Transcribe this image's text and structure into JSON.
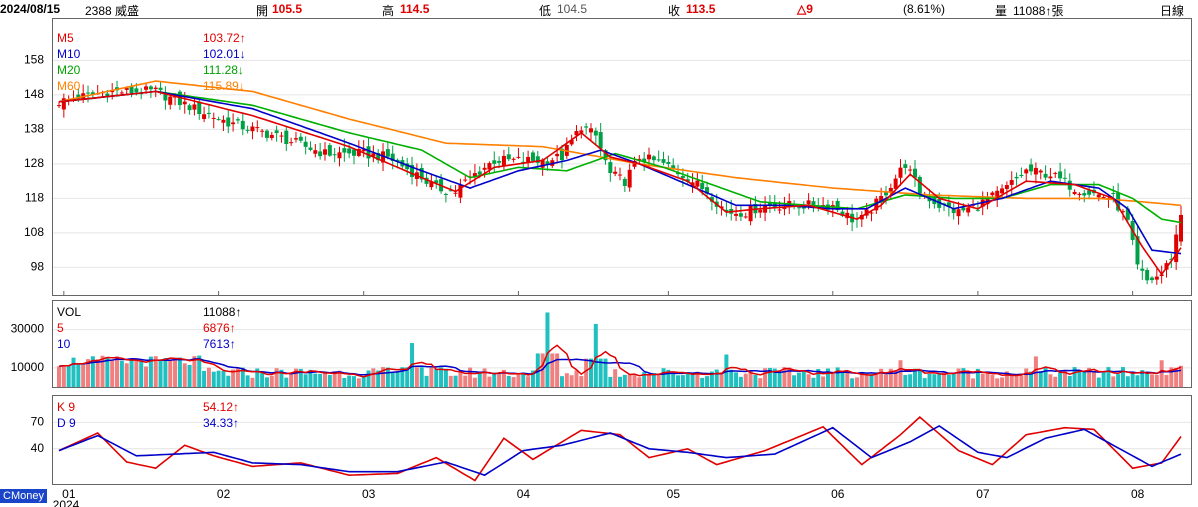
{
  "header": {
    "date": "2024/08/15",
    "stock": "2388 威盛",
    "open_label": "開",
    "open": "105.5",
    "high_label": "高",
    "high": "114.5",
    "low_label": "低",
    "low": "104.5",
    "close_label": "收",
    "close": "113.5",
    "change": "△9",
    "change_pct": "(8.61%)",
    "volume_label": "量",
    "volume": "11088↑張",
    "period": "日線"
  },
  "brand": "CMoney",
  "colors": {
    "up": "#e00000",
    "down": "#00a046",
    "ma5": "#e00000",
    "ma10": "#0000c8",
    "ma20": "#00b000",
    "ma60": "#ff8000",
    "vol_up": "#f08080",
    "vol_down": "#20c0c0"
  },
  "chart_data": [
    {
      "type": "candlestick",
      "legend": [
        {
          "name": "M5",
          "value": "103.72↑",
          "color": "#e00000"
        },
        {
          "name": "M10",
          "value": "102.01↓",
          "color": "#0000c8"
        },
        {
          "name": "M20",
          "value": "111.28↓",
          "color": "#00a000"
        },
        {
          "name": "M60",
          "value": "115.89↓",
          "color": "#ff8000"
        }
      ],
      "y_ticks": [
        98,
        108,
        118,
        128,
        138,
        148,
        158
      ],
      "ylim": [
        90,
        170
      ],
      "x_ticks": [
        "01",
        "02",
        "03",
        "04",
        "05",
        "06",
        "07",
        "08"
      ],
      "x_tick_positions": [
        1,
        33,
        63,
        95,
        126,
        160,
        190,
        222
      ],
      "year_label": "2024",
      "n_days": 233,
      "close_anchors": [
        [
          0,
          146
        ],
        [
          10,
          149
        ],
        [
          20,
          149
        ],
        [
          28,
          144
        ],
        [
          35,
          140
        ],
        [
          45,
          136
        ],
        [
          55,
          131
        ],
        [
          62,
          131
        ],
        [
          68,
          130
        ],
        [
          75,
          124
        ],
        [
          78,
          121
        ],
        [
          82,
          120
        ],
        [
          85,
          124
        ],
        [
          90,
          129
        ],
        [
          95,
          129
        ],
        [
          100,
          129
        ],
        [
          104,
          130
        ],
        [
          108,
          139
        ],
        [
          111,
          136
        ],
        [
          114,
          125
        ],
        [
          117,
          123
        ],
        [
          120,
          130
        ],
        [
          125,
          128
        ],
        [
          130,
          124
        ],
        [
          134,
          120
        ],
        [
          138,
          114
        ],
        [
          142,
          114
        ],
        [
          146,
          116
        ],
        [
          150,
          116
        ],
        [
          155,
          116
        ],
        [
          160,
          116
        ],
        [
          164,
          112
        ],
        [
          166,
          112
        ],
        [
          170,
          118
        ],
        [
          175,
          128
        ],
        [
          178,
          120
        ],
        [
          182,
          116
        ],
        [
          186,
          114
        ],
        [
          190,
          116
        ],
        [
          195,
          120
        ],
        [
          200,
          126
        ],
        [
          205,
          125
        ],
        [
          210,
          121
        ],
        [
          215,
          119
        ],
        [
          218,
          118
        ],
        [
          221,
          111
        ],
        [
          223,
          98
        ],
        [
          225,
          94
        ],
        [
          228,
          96
        ],
        [
          230,
          101
        ],
        [
          232,
          113.5
        ]
      ],
      "ma60_anchors": [
        [
          0,
          146
        ],
        [
          20,
          152
        ],
        [
          40,
          149
        ],
        [
          60,
          141
        ],
        [
          80,
          134
        ],
        [
          100,
          133
        ],
        [
          120,
          128
        ],
        [
          140,
          124
        ],
        [
          160,
          121
        ],
        [
          180,
          119
        ],
        [
          200,
          118
        ],
        [
          215,
          118
        ],
        [
          224,
          117
        ],
        [
          232,
          116
        ]
      ],
      "ma20_anchors": [
        [
          0,
          146
        ],
        [
          20,
          149
        ],
        [
          40,
          145
        ],
        [
          60,
          137
        ],
        [
          75,
          132
        ],
        [
          85,
          124
        ],
        [
          95,
          127
        ],
        [
          105,
          126
        ],
        [
          115,
          131
        ],
        [
          125,
          127
        ],
        [
          135,
          122
        ],
        [
          145,
          117
        ],
        [
          155,
          116
        ],
        [
          165,
          115
        ],
        [
          175,
          119
        ],
        [
          185,
          118
        ],
        [
          195,
          118
        ],
        [
          205,
          122
        ],
        [
          215,
          122
        ],
        [
          222,
          118
        ],
        [
          228,
          112
        ],
        [
          232,
          111
        ]
      ],
      "ma10_anchors": [
        [
          0,
          146
        ],
        [
          20,
          149
        ],
        [
          40,
          144
        ],
        [
          60,
          134
        ],
        [
          75,
          126
        ],
        [
          85,
          121
        ],
        [
          95,
          126
        ],
        [
          105,
          129
        ],
        [
          112,
          132
        ],
        [
          120,
          128
        ],
        [
          130,
          122
        ],
        [
          140,
          116
        ],
        [
          150,
          116
        ],
        [
          160,
          115
        ],
        [
          167,
          115
        ],
        [
          175,
          121
        ],
        [
          185,
          115
        ],
        [
          195,
          118
        ],
        [
          205,
          123
        ],
        [
          215,
          121
        ],
        [
          221,
          115
        ],
        [
          226,
          103
        ],
        [
          232,
          102
        ]
      ],
      "ma5_anchors": [
        [
          0,
          146
        ],
        [
          20,
          149
        ],
        [
          40,
          142
        ],
        [
          60,
          133
        ],
        [
          75,
          124
        ],
        [
          82,
          120
        ],
        [
          90,
          127
        ],
        [
          100,
          129
        ],
        [
          108,
          137
        ],
        [
          114,
          130
        ],
        [
          120,
          128
        ],
        [
          130,
          123
        ],
        [
          138,
          114
        ],
        [
          145,
          115
        ],
        [
          155,
          116
        ],
        [
          165,
          112
        ],
        [
          170,
          116
        ],
        [
          176,
          125
        ],
        [
          182,
          118
        ],
        [
          190,
          115
        ],
        [
          200,
          123
        ],
        [
          210,
          122
        ],
        [
          218,
          118
        ],
        [
          224,
          104
        ],
        [
          228,
          96
        ],
        [
          232,
          103.7
        ]
      ]
    },
    {
      "type": "bar",
      "legend": [
        {
          "name": "VOL",
          "value": "11088↑",
          "color": "#000"
        },
        {
          "name": "5",
          "value": "6876↑",
          "color": "#e00000"
        },
        {
          "name": "10",
          "value": "7613↑",
          "color": "#0000c8"
        }
      ],
      "y_ticks": [
        10000,
        30000
      ],
      "ylim": [
        0,
        45000
      ],
      "peak_volumes": [
        [
          101,
          39000
        ],
        [
          111,
          33000
        ],
        [
          73,
          23000
        ],
        [
          138,
          17000
        ],
        [
          174,
          14000
        ],
        [
          202,
          16000
        ],
        [
          228,
          14000
        ],
        [
          232,
          11088
        ]
      ]
    },
    {
      "type": "line",
      "legend": [
        {
          "name": "K 9",
          "value": "54.12↑",
          "color": "#e00000"
        },
        {
          "name": "D 9",
          "value": "34.33↑",
          "color": "#0000c8"
        }
      ],
      "y_ticks": [
        40,
        70
      ],
      "ylim": [
        0,
        100
      ],
      "k_anchors": [
        [
          0,
          38
        ],
        [
          8,
          58
        ],
        [
          14,
          25
        ],
        [
          20,
          18
        ],
        [
          26,
          44
        ],
        [
          32,
          32
        ],
        [
          40,
          20
        ],
        [
          50,
          24
        ],
        [
          60,
          10
        ],
        [
          70,
          12
        ],
        [
          78,
          30
        ],
        [
          86,
          4
        ],
        [
          92,
          52
        ],
        [
          98,
          28
        ],
        [
          108,
          61
        ],
        [
          116,
          56
        ],
        [
          122,
          30
        ],
        [
          130,
          40
        ],
        [
          136,
          22
        ],
        [
          146,
          38
        ],
        [
          158,
          65
        ],
        [
          166,
          22
        ],
        [
          174,
          56
        ],
        [
          178,
          76
        ],
        [
          186,
          38
        ],
        [
          193,
          22
        ],
        [
          200,
          56
        ],
        [
          208,
          64
        ],
        [
          214,
          62
        ],
        [
          222,
          18
        ],
        [
          228,
          24
        ],
        [
          232,
          54
        ]
      ],
      "d_anchors": [
        [
          0,
          38
        ],
        [
          8,
          55
        ],
        [
          16,
          32
        ],
        [
          24,
          34
        ],
        [
          32,
          36
        ],
        [
          40,
          24
        ],
        [
          50,
          22
        ],
        [
          60,
          14
        ],
        [
          70,
          14
        ],
        [
          80,
          25
        ],
        [
          88,
          10
        ],
        [
          96,
          38
        ],
        [
          104,
          44
        ],
        [
          114,
          58
        ],
        [
          122,
          40
        ],
        [
          130,
          36
        ],
        [
          138,
          30
        ],
        [
          148,
          34
        ],
        [
          160,
          64
        ],
        [
          168,
          30
        ],
        [
          176,
          48
        ],
        [
          182,
          66
        ],
        [
          190,
          36
        ],
        [
          196,
          30
        ],
        [
          204,
          52
        ],
        [
          212,
          62
        ],
        [
          220,
          38
        ],
        [
          226,
          20
        ],
        [
          232,
          34
        ]
      ]
    }
  ]
}
